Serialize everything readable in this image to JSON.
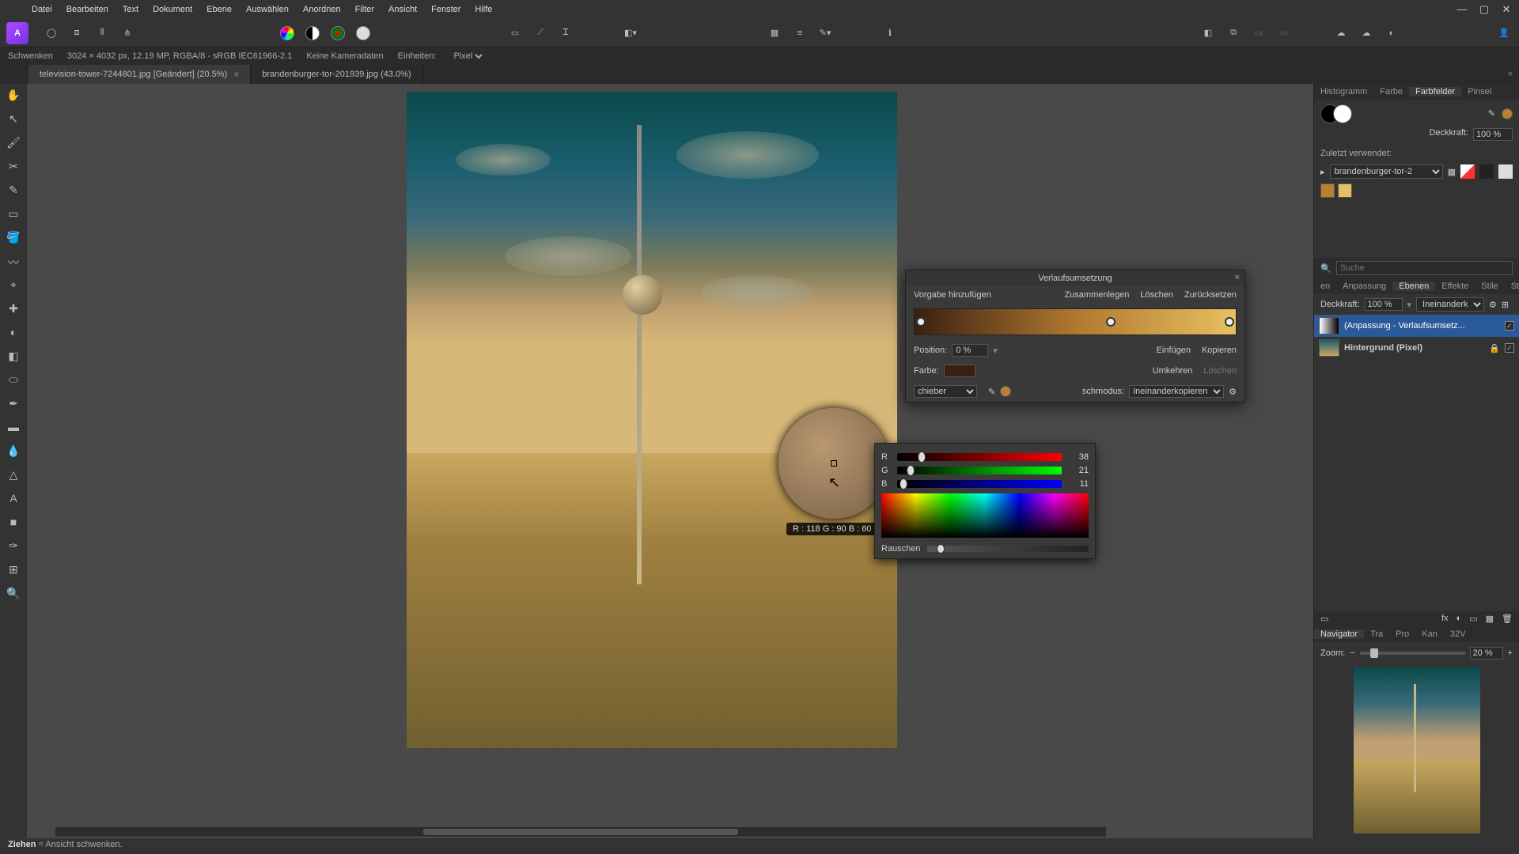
{
  "menu": {
    "items": [
      "Datei",
      "Bearbeiten",
      "Text",
      "Dokument",
      "Ebene",
      "Auswählen",
      "Anordnen",
      "Filter",
      "Ansicht",
      "Fenster",
      "Hilfe"
    ]
  },
  "info": {
    "tool": "Schwenken",
    "dims": "3024 × 4032 px, 12.19 MP, RGBA/8 - sRGB IEC61966-2.1",
    "camera": "Keine Kameradaten",
    "units_label": "Einheiten:",
    "units_value": "Pixel"
  },
  "tabs": [
    {
      "label": "television-tower-7244801.jpg [Geändert] (20.5%)",
      "active": true
    },
    {
      "label": "brandenburger-tor-201939.jpg (43.0%)",
      "active": false
    }
  ],
  "magnifier_readout": "R : 118 G : 90 B : 60",
  "dialog": {
    "title": "Verlaufsumsetzung",
    "add_preset": "Vorgabe hinzufügen",
    "merge": "Zusammenlegen",
    "delete": "Löschen",
    "reset": "Zurücksetzen",
    "position_label": "Position:",
    "position_value": "0 %",
    "color_label": "Farbe:",
    "color_value": "#3a2010",
    "insert": "Einfügen",
    "copy": "Kopieren",
    "invert": "Umkehren",
    "delete2": "Löschen",
    "mode_label": "chieber",
    "blend_label": "schmodus:",
    "blend_value": "Ineinanderkopieren",
    "gradient_stops": [
      0,
      61,
      100
    ]
  },
  "color_popup": {
    "r": {
      "label": "R",
      "value": 38,
      "pct": 15,
      "grad": "linear-gradient(90deg,#000,#f00)"
    },
    "g": {
      "label": "G",
      "value": 21,
      "pct": 8,
      "grad": "linear-gradient(90deg,#000,#0f0)"
    },
    "b": {
      "label": "B",
      "value": 11,
      "pct": 4,
      "grad": "linear-gradient(90deg,#000,#00f)"
    },
    "noise_label": "Rauschen"
  },
  "right_panels": {
    "top_tabs": [
      "Histogramm",
      "Farbe",
      "Farbfelder",
      "Pinsel"
    ],
    "top_active": 2,
    "opacity_label": "Deckkraft:",
    "opacity_value": "100 %",
    "recent_label": "Zuletzt verwendet:",
    "asset_name": "brandenburger-tor-2",
    "recent_colors": [
      "#b88030",
      "#e8c060"
    ],
    "search_placeholder": "Suche",
    "mid_tabs": [
      "en",
      "Anpassung",
      "Ebenen",
      "Effekte",
      "Stile",
      "Stock"
    ],
    "mid_active": 2,
    "layer_opacity_label": "Deckkraft:",
    "layer_opacity_value": "100 %",
    "blend_value": "Ineinanderko",
    "layers": [
      {
        "name": "(Anpassung - Verlaufsumsetz...",
        "selected": true
      },
      {
        "name": "Hintergrund (Pixel)",
        "selected": false
      }
    ],
    "nav_tabs": [
      "Navigator",
      "Tra",
      "Pro",
      "Kan",
      "32V"
    ],
    "nav_active": 0,
    "zoom_label": "Zoom:",
    "zoom_value": "20 %"
  },
  "status": {
    "action": "Ziehen",
    "desc": "= Ansicht schwenken."
  }
}
